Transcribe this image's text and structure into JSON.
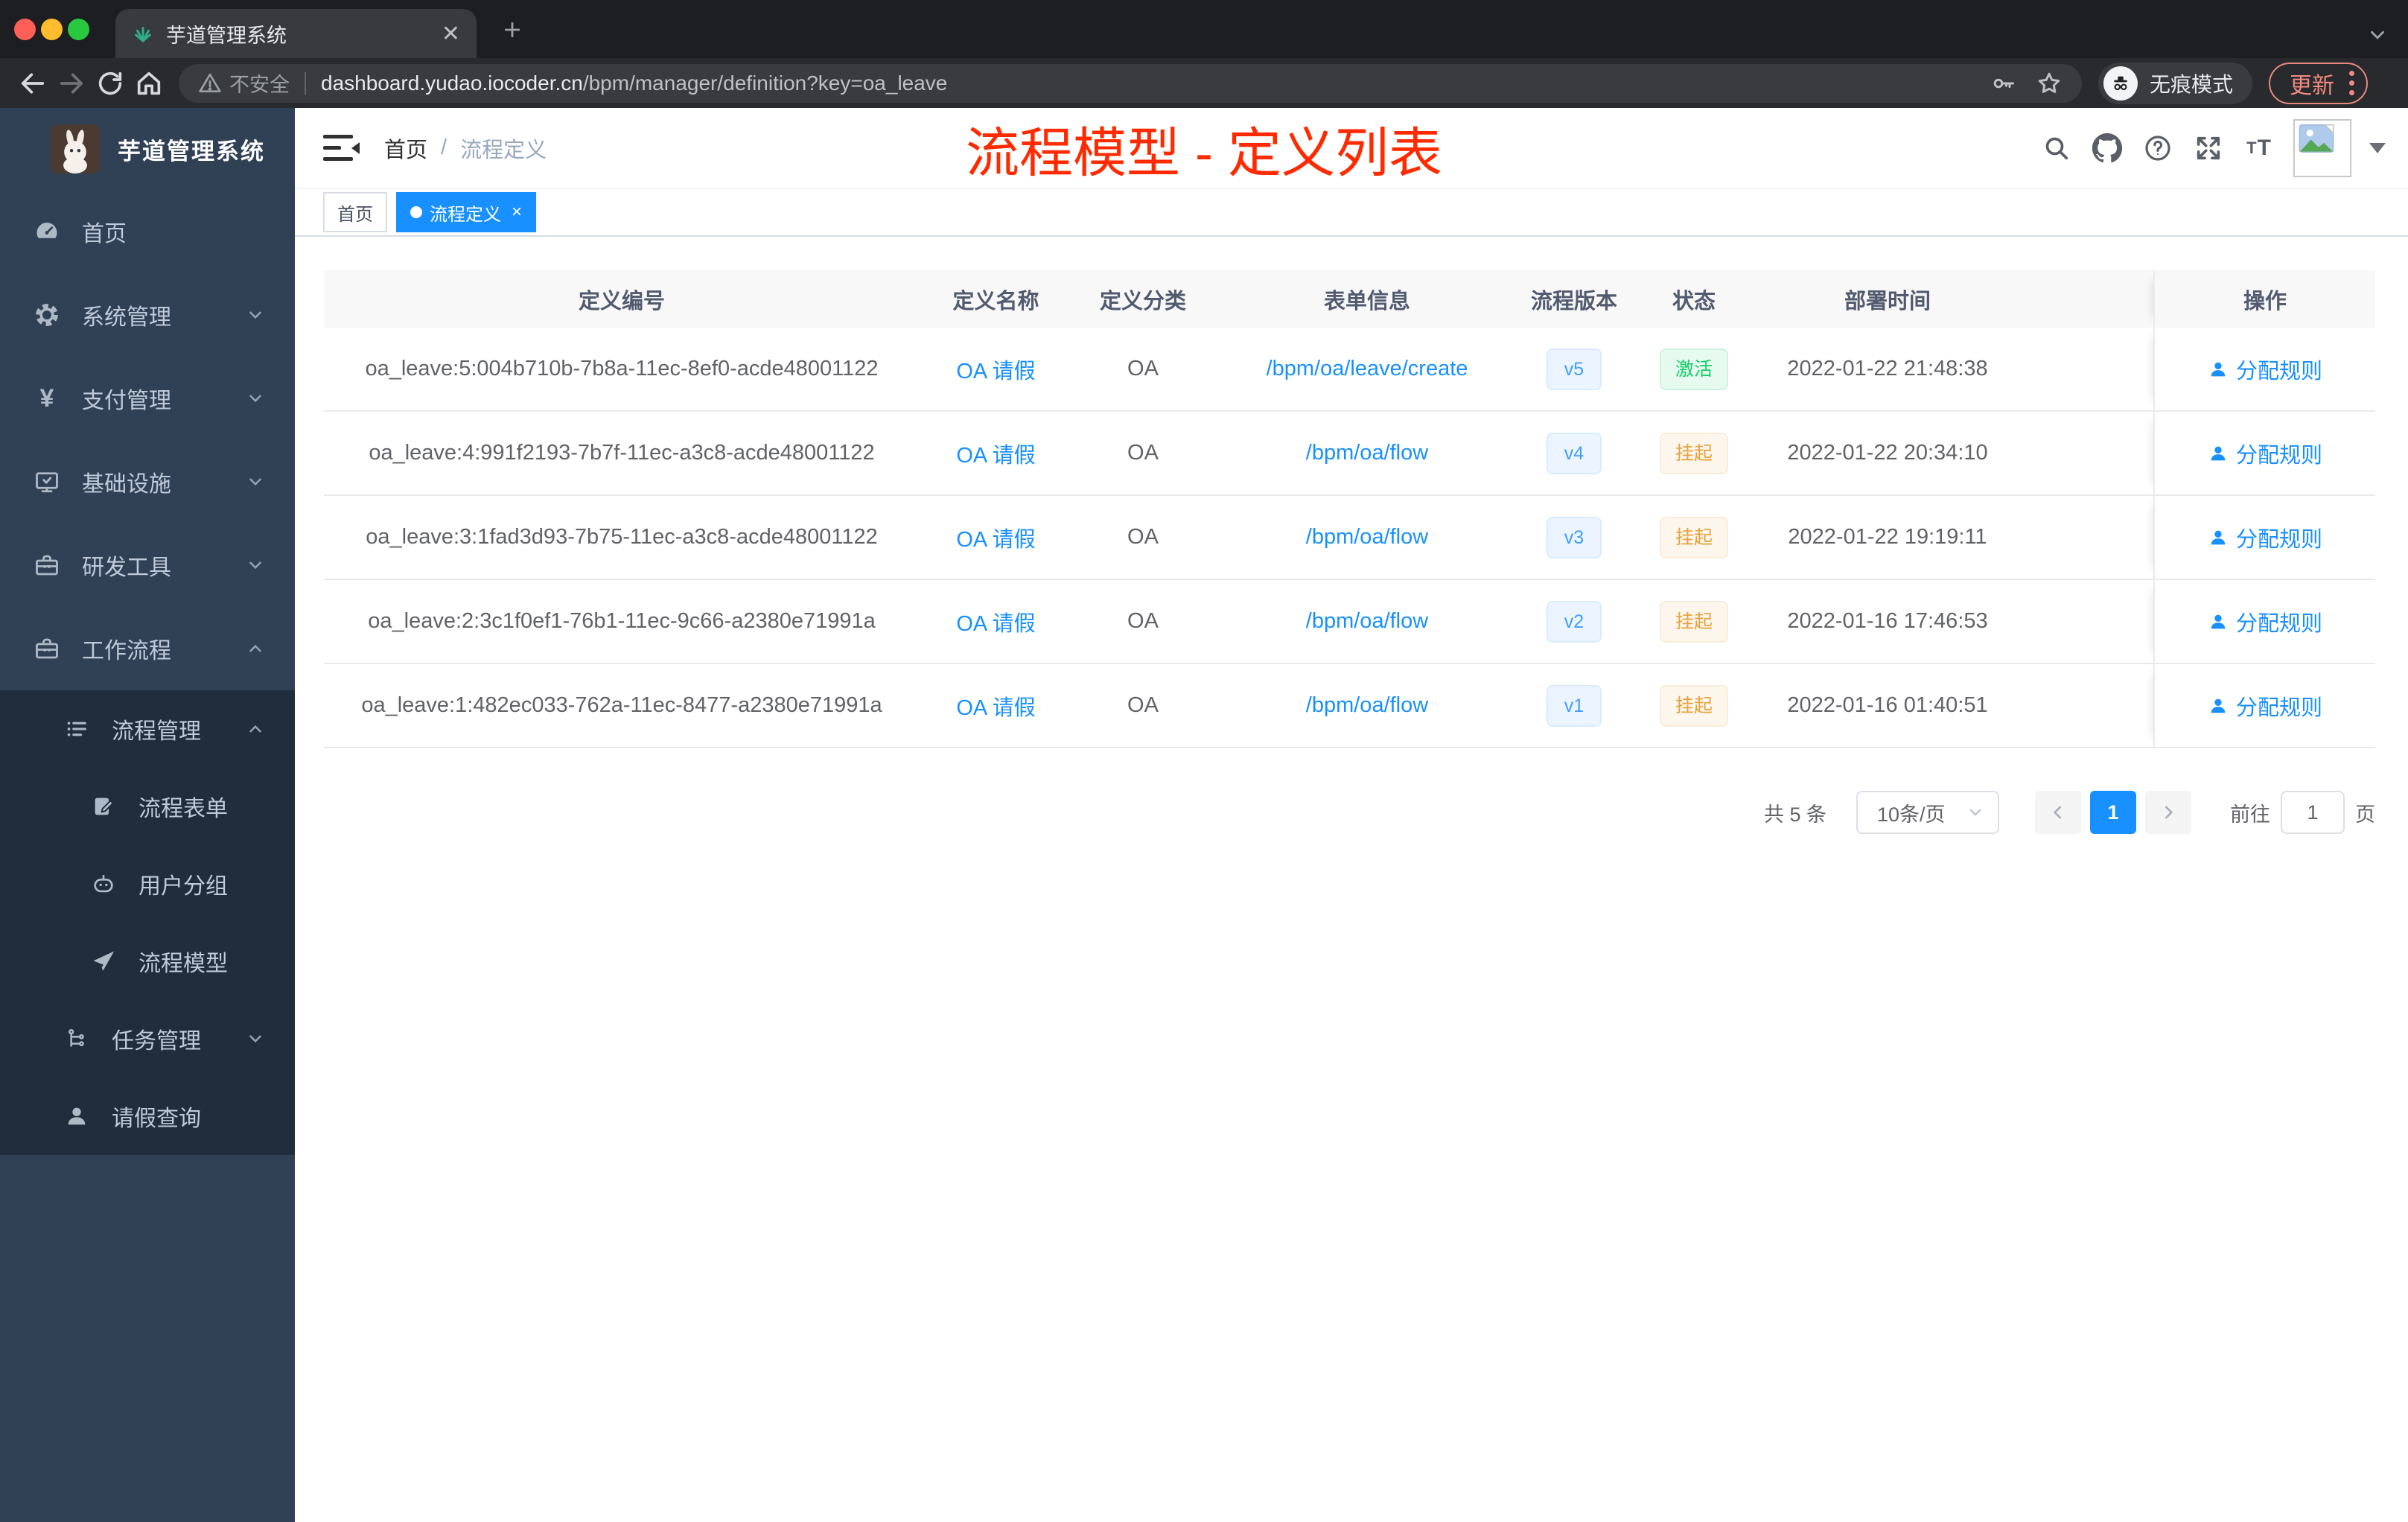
{
  "browser": {
    "tab_title": "芋道管理系统",
    "security_label": "不安全",
    "url_domain": "dashboard.yudao.iocoder.cn",
    "url_path": "/bpm/manager/definition?key=oa_leave",
    "incognito_label": "无痕模式",
    "update_label": "更新",
    "traffic_colors": {
      "close": "#ff5f57",
      "minimize": "#febc2e",
      "zoom": "#28c840"
    }
  },
  "sidebar": {
    "app_title": "芋道管理系统",
    "items": [
      {
        "label": "首页",
        "icon": "dashboard-icon",
        "level": 0
      },
      {
        "label": "系统管理",
        "icon": "gear-icon",
        "level": 0,
        "arrow": "down"
      },
      {
        "label": "支付管理",
        "icon": "yen-icon",
        "level": 0,
        "arrow": "down"
      },
      {
        "label": "基础设施",
        "icon": "monitor-icon",
        "level": 0,
        "arrow": "down"
      },
      {
        "label": "研发工具",
        "icon": "toolbox-icon",
        "level": 0,
        "arrow": "down"
      },
      {
        "label": "工作流程",
        "icon": "toolbox-icon",
        "level": 0,
        "arrow": "up",
        "expanded": true
      },
      {
        "label": "流程管理",
        "icon": "list-icon",
        "level": 1,
        "arrow": "up",
        "expanded": true
      },
      {
        "label": "流程表单",
        "icon": "form-icon",
        "level": 2
      },
      {
        "label": "用户分组",
        "icon": "robot-icon",
        "level": 2
      },
      {
        "label": "流程模型",
        "icon": "send-icon",
        "level": 2
      },
      {
        "label": "任务管理",
        "icon": "tree-icon",
        "level": 1,
        "arrow": "down"
      },
      {
        "label": "请假查询",
        "icon": "user-icon",
        "level": 1
      }
    ]
  },
  "navbar": {
    "breadcrumb": [
      "首页",
      "流程定义"
    ],
    "separator": "/",
    "icons": [
      "search",
      "github",
      "question",
      "fullscreen",
      "font-size",
      "avatar",
      "caret-down"
    ]
  },
  "annotation": {
    "text": "流程模型 - 定义列表",
    "color": "#ff2a00"
  },
  "tags": [
    {
      "label": "首页",
      "active": false
    },
    {
      "label": "流程定义",
      "active": true
    }
  ],
  "table": {
    "columns": [
      "定义编号",
      "定义名称",
      "定义分类",
      "表单信息",
      "流程版本",
      "状态",
      "部署时间",
      "操作"
    ],
    "rows": [
      {
        "id": "oa_leave:5:004b710b-7b8a-11ec-8ef0-acde48001122",
        "name": "OA 请假",
        "category": "OA",
        "form": "/bpm/oa/leave/create",
        "version": "v5",
        "status": "激活",
        "status_type": "success",
        "deploy_time": "2022-01-22 21:48:38",
        "action": "分配规则"
      },
      {
        "id": "oa_leave:4:991f2193-7b7f-11ec-a3c8-acde48001122",
        "name": "OA 请假",
        "category": "OA",
        "form": "/bpm/oa/flow",
        "version": "v4",
        "status": "挂起",
        "status_type": "warning",
        "deploy_time": "2022-01-22 20:34:10",
        "action": "分配规则"
      },
      {
        "id": "oa_leave:3:1fad3d93-7b75-11ec-a3c8-acde48001122",
        "name": "OA 请假",
        "category": "OA",
        "form": "/bpm/oa/flow",
        "version": "v3",
        "status": "挂起",
        "status_type": "warning",
        "deploy_time": "2022-01-22 19:19:11",
        "action": "分配规则"
      },
      {
        "id": "oa_leave:2:3c1f0ef1-76b1-11ec-9c66-a2380e71991a",
        "name": "OA 请假",
        "category": "OA",
        "form": "/bpm/oa/flow",
        "version": "v2",
        "status": "挂起",
        "status_type": "warning",
        "deploy_time": "2022-01-16 17:46:53",
        "action": "分配规则"
      },
      {
        "id": "oa_leave:1:482ec033-762a-11ec-8477-a2380e71991a",
        "name": "OA 请假",
        "category": "OA",
        "form": "/bpm/oa/flow",
        "version": "v1",
        "status": "挂起",
        "status_type": "warning",
        "deploy_time": "2022-01-16 01:40:51",
        "action": "分配规则"
      }
    ]
  },
  "pagination": {
    "total": "共 5 条",
    "page_size": "10条/页",
    "current": "1",
    "goto_label": "前往",
    "goto_value": "1",
    "unit": "页"
  },
  "colors": {
    "accent": "#1890ff",
    "annotation_red": "#ff2a00",
    "sidebar_bg": "#304156",
    "submenu_bg": "#1f2d3d",
    "tag_success_text": "#13ce66",
    "tag_warning_text": "#e6a23c",
    "tag_version_text": "#409eff"
  }
}
